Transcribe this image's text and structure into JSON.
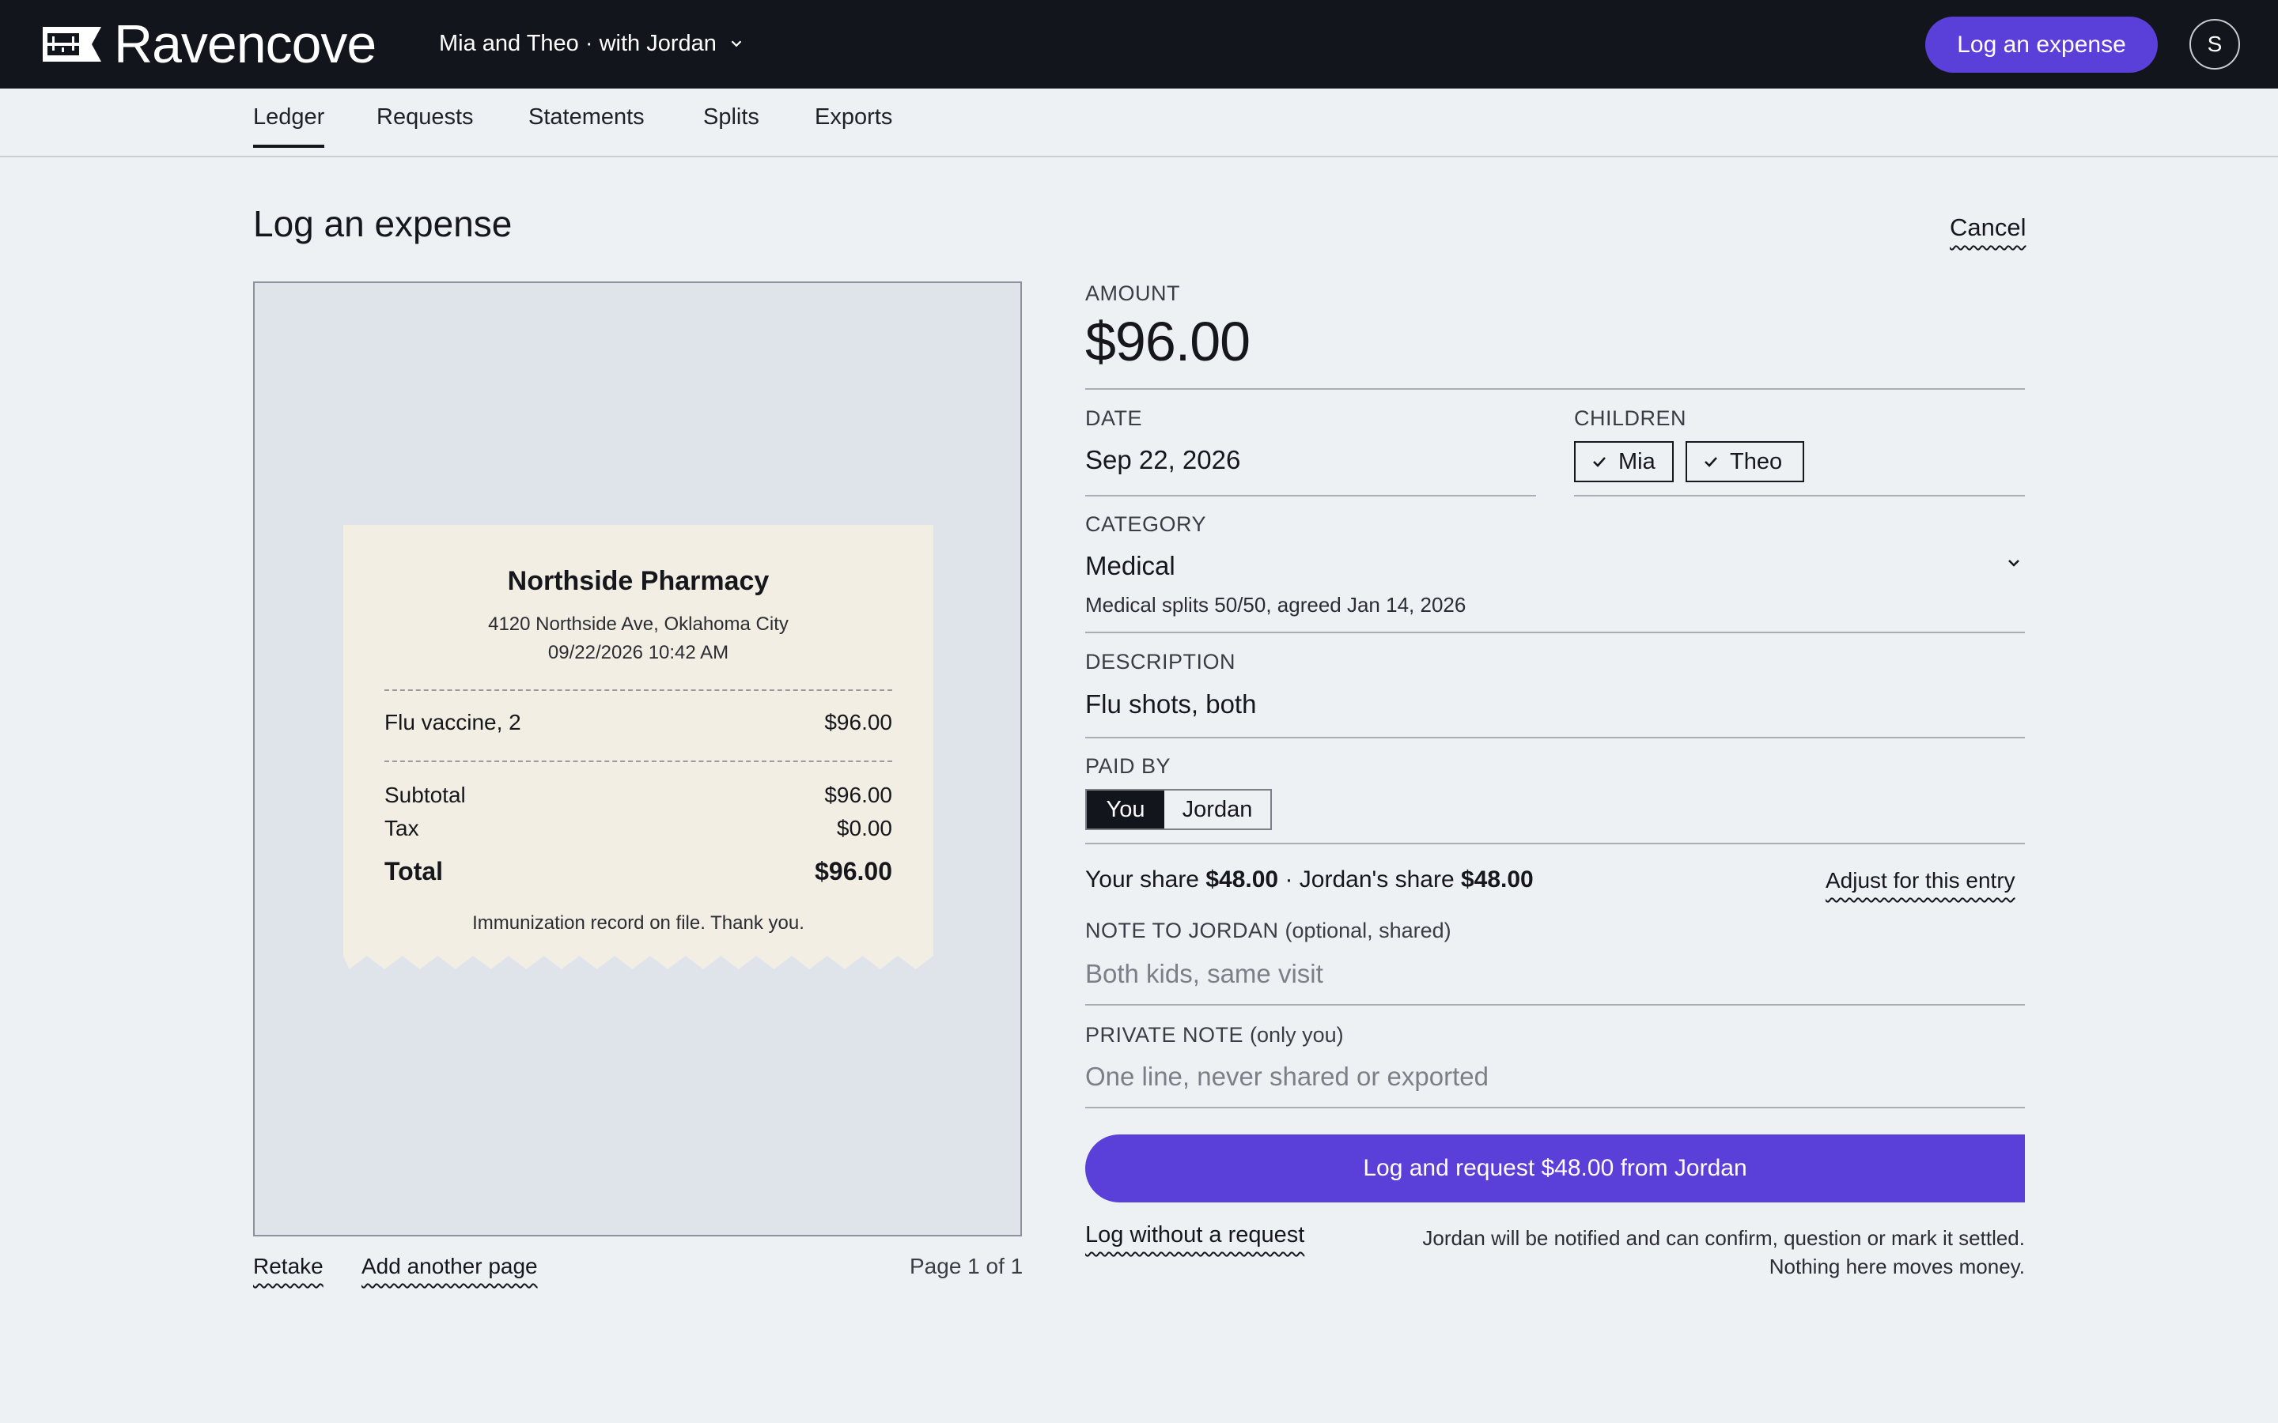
{
  "app": {
    "name": "Ravencove",
    "family_switcher": "Mia and Theo · with Jordan",
    "cta": "Log an expense",
    "avatar_initial": "S"
  },
  "nav": {
    "tabs": [
      "Ledger",
      "Requests",
      "Statements",
      "Splits",
      "Exports"
    ],
    "active": "Ledger"
  },
  "page": {
    "title": "Log an expense",
    "cancel": "Cancel"
  },
  "receipt": {
    "store": "Northside Pharmacy",
    "address": "4120 Northside Ave, Oklahoma City",
    "datetime": "09/22/2026 10:42 AM",
    "line_item": {
      "name": "Flu vaccine, 2",
      "amount": "$96.00"
    },
    "subtotal": {
      "label": "Subtotal",
      "amount": "$96.00"
    },
    "tax": {
      "label": "Tax",
      "amount": "$0.00"
    },
    "total": {
      "label": "Total",
      "amount": "$96.00"
    },
    "footer": "Immunization record on file. Thank you."
  },
  "viewer": {
    "retake": "Retake",
    "add_page": "Add another page",
    "page_indicator": "Page 1 of 1"
  },
  "form": {
    "amount": {
      "label": "AMOUNT",
      "value": "$96.00"
    },
    "date": {
      "label": "DATE",
      "value": "Sep 22, 2026"
    },
    "children": {
      "label": "CHILDREN",
      "options": [
        "Mia",
        "Theo"
      ]
    },
    "category": {
      "label": "CATEGORY",
      "value": "Medical",
      "hint": "Medical splits 50/50, agreed Jan 14, 2026"
    },
    "description": {
      "label": "DESCRIPTION",
      "value": "Flu shots, both"
    },
    "paid_by": {
      "label": "PAID BY",
      "options": [
        "You",
        "Jordan"
      ],
      "selected": "You"
    },
    "shares": {
      "your_label": "Your share",
      "your_amount": "$48.00",
      "sep": "·",
      "other_label": "Jordan's share",
      "other_amount": "$48.00",
      "adjust": "Adjust for this entry"
    },
    "note_to_jordan": {
      "label": "NOTE TO JORDAN",
      "sub": "(optional, shared)",
      "placeholder": "Both kids, same visit"
    },
    "private_note": {
      "label": "PRIVATE NOTE",
      "sub": "(only you)",
      "placeholder": "One line, never shared or exported"
    },
    "submit": "Log and request $48.00 from Jordan",
    "log_without": "Log without a request",
    "notice_line1": "Jordan will be notified and can confirm, question or mark it settled.",
    "notice_line2": "Nothing here moves money."
  },
  "colors": {
    "topbar": "#12151b",
    "accent": "#5b3fd9",
    "page_bg": "#eef1f4",
    "receipt_paper": "#f3eee3",
    "viewer_bg": "#dfe3ea"
  },
  "icons": [
    "logo-mark-icon",
    "chevron-down-icon",
    "check-icon"
  ]
}
